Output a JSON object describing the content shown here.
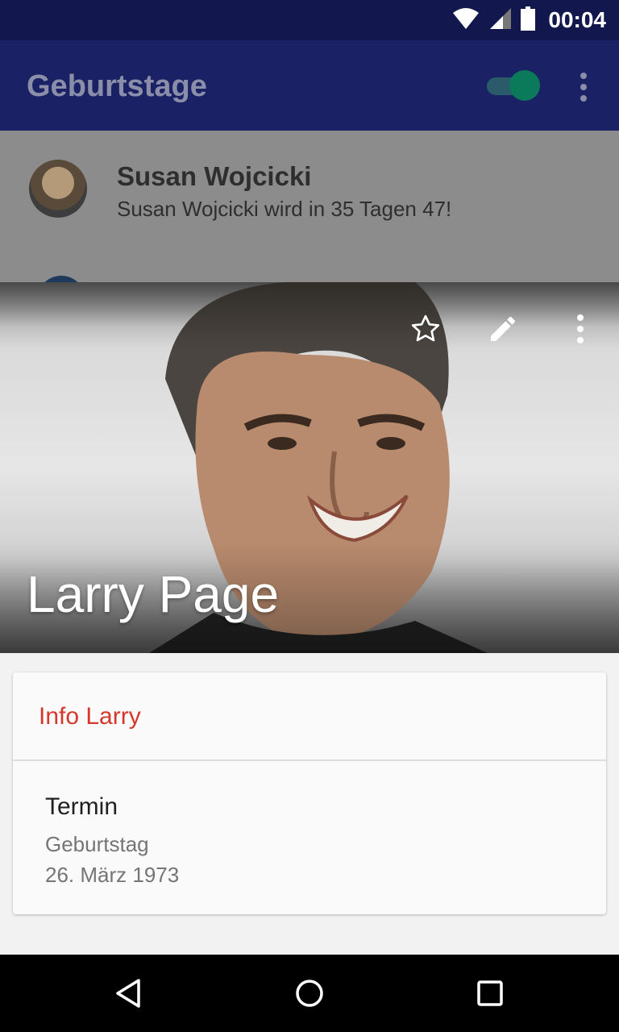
{
  "status_bar": {
    "time": "00:04"
  },
  "app_bar": {
    "title": "Geburtstage"
  },
  "list": {
    "items": [
      {
        "name": "Susan Wojcicki",
        "subtitle": "Susan Wojcicki wird in 35 Tagen 47!"
      }
    ]
  },
  "detail": {
    "name": "Larry Page",
    "actions": [
      "star-icon",
      "edit-icon",
      "more-vert-icon"
    ]
  },
  "card": {
    "title": "Info Larry",
    "label": "Termin",
    "event_type": "Geburtstag",
    "date": "26. März 1973"
  },
  "colors": {
    "primary": "#1a237e",
    "accent": "#009688",
    "card_title": "#d4382c"
  }
}
